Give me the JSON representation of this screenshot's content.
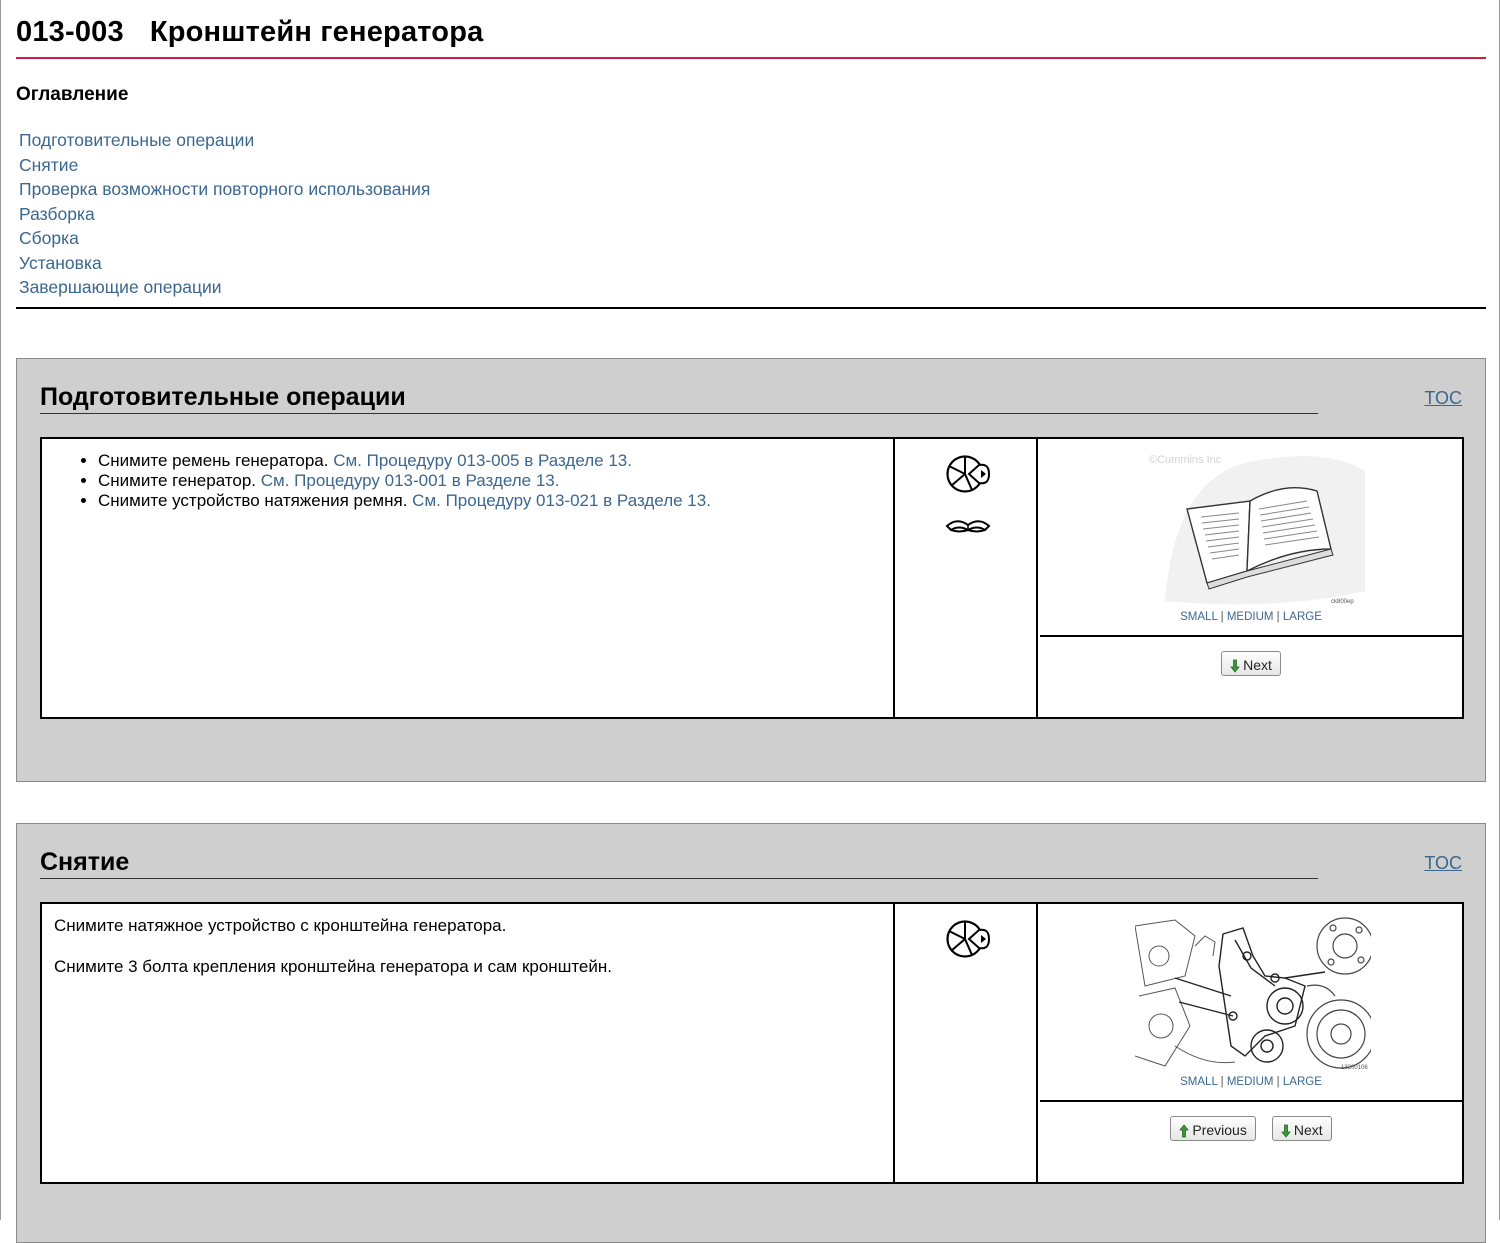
{
  "page": {
    "code": "013-003",
    "title": "Кронштейн генератора"
  },
  "toc": {
    "heading": "Оглавление",
    "items": [
      "Подготовительные операции",
      "Снятие",
      "Проверка возможности повторного использования",
      "Разборка",
      "Сборка",
      "Установка",
      "Завершающие операции"
    ]
  },
  "sections": [
    {
      "title": "Подготовительные операции",
      "toc_link": "TOC",
      "bullets": [
        {
          "text": "Снимите ремень генератора. ",
          "link": "См. Процедуру 013-005 в Разделе 13."
        },
        {
          "text": "Снимите генератор. ",
          "link": "См. Процедуру 013-001 в Разделе 13."
        },
        {
          "text": "Снимите устройство натяжения ремня. ",
          "link": "См. Процедуру 013-021 в Разделе 13."
        }
      ],
      "icons": [
        "wrench-tool-icon",
        "manual-book-icon"
      ],
      "figure": {
        "alt": "open-manual-illustration",
        "watermark": "©Cummins Inc",
        "fig_id": "ck800ep"
      },
      "sizes": {
        "small": "SMALL",
        "medium": "MEDIUM",
        "large": "LARGE",
        "sep": "|"
      },
      "nav": {
        "next": "Next"
      }
    },
    {
      "title": "Снятие",
      "toc_link": "TOC",
      "paragraphs": [
        "Снимите натяжное устройство с кронштейна генератора.",
        "Снимите 3 болта крепления кронштейна генератора и сам кронштейн."
      ],
      "icons": [
        "wrench-tool-icon"
      ],
      "figure": {
        "alt": "alternator-bracket-illustration",
        "fig_id": "13200106"
      },
      "sizes": {
        "small": "SMALL",
        "medium": "MEDIUM",
        "large": "LARGE",
        "sep": "|"
      },
      "nav": {
        "previous": "Previous",
        "next": "Next"
      }
    }
  ],
  "colors": {
    "accent_rule": "#cf1e3c",
    "link": "#3b6790",
    "section_bg": "#cfcfcf"
  }
}
